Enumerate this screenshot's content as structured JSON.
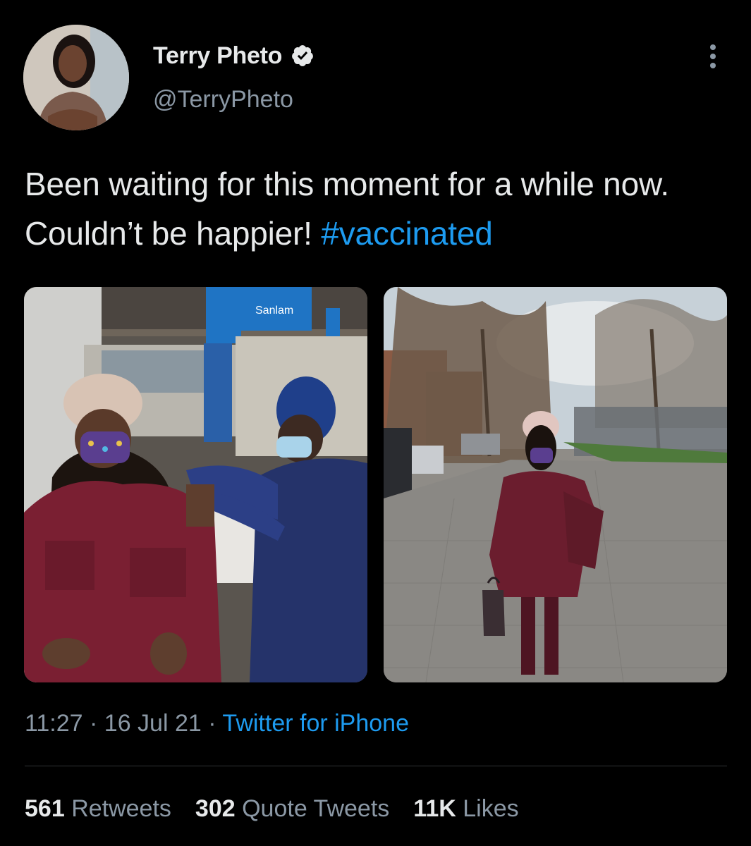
{
  "user": {
    "display_name": "Terry Pheto",
    "handle": "@TerryPheto",
    "verified": true
  },
  "tweet": {
    "text_main": "Been waiting for this moment for a while now. Couldn’t be happier!",
    "hashtag": "#vaccinated",
    "images": [
      {
        "sign_text_1": "Sanlam",
        "sign_text_2": "Sanlam"
      },
      {}
    ],
    "time": "11:27",
    "date": "16 Jul 21",
    "separator": "·",
    "source": "Twitter for iPhone"
  },
  "stats": {
    "retweets_count": "561",
    "retweets_label": "Retweets",
    "quotes_count": "302",
    "quotes_label": "Quote Tweets",
    "likes_count": "11K",
    "likes_label": "Likes"
  },
  "colors": {
    "background": "#000000",
    "text": "#e7e9ea",
    "secondary": "#8b98a5",
    "accent": "#1d9bf0",
    "divider": "#2f3336"
  },
  "icons": [
    "verified-badge-icon",
    "more-options-icon"
  ]
}
